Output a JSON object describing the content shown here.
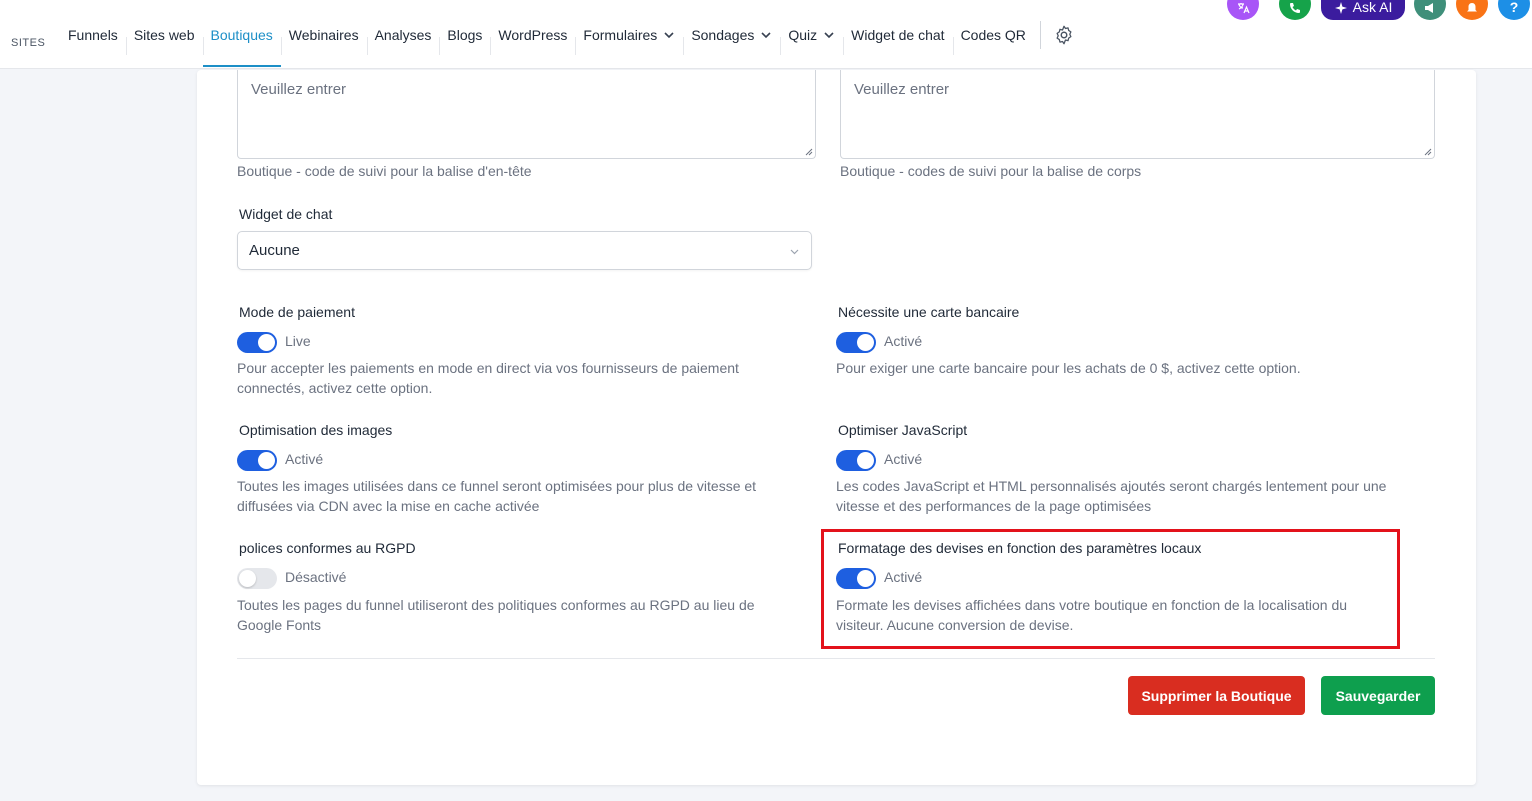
{
  "nav": {
    "sites_label": "SITES",
    "items": [
      {
        "label": "Funnels"
      },
      {
        "label": "Sites web"
      },
      {
        "label": "Boutiques",
        "active": true
      },
      {
        "label": "Webinaires"
      },
      {
        "label": "Analyses"
      },
      {
        "label": "Blogs"
      },
      {
        "label": "WordPress"
      },
      {
        "label": "Formulaires",
        "dropdown": true
      },
      {
        "label": "Sondages",
        "dropdown": true
      },
      {
        "label": "Quiz",
        "dropdown": true
      },
      {
        "label": "Widget de chat"
      },
      {
        "label": "Codes QR"
      }
    ],
    "settings_icon": "gear-icon"
  },
  "topbar": {
    "ask_ai_label": "Ask AI",
    "colors": {
      "translate": "#a855f7",
      "phone": "#16a34a",
      "ask_ai": "#3b1c9e",
      "megaphone": "#3f8f7a",
      "bell": "#f97316",
      "help": "#1d8fe6"
    }
  },
  "tracking": {
    "head_placeholder": "Veuillez entrer",
    "head_hint": "Boutique - code de suivi pour la balise d'en-tête",
    "body_placeholder": "Veuillez entrer",
    "body_hint": "Boutique - codes de suivi pour la balise de corps"
  },
  "chat_widget": {
    "label": "Widget de chat",
    "value": "Aucune"
  },
  "settings": {
    "payment_mode": {
      "label": "Mode de paiement",
      "state": "Live",
      "on": true,
      "hint_line1": "Pour accepter les paiements en mode en direct via vos fournisseurs de paiement",
      "hint_line2": "connectés, activez cette option."
    },
    "card_required": {
      "label": "Nécessite une carte bancaire",
      "state": "Activé",
      "on": true,
      "hint_line1": "Pour exiger une carte bancaire pour les achats de 0 $, activez cette option."
    },
    "image_opt": {
      "label": "Optimisation des images",
      "state": "Activé",
      "on": true,
      "hint_line1": "Toutes les images utilisées dans ce funnel seront optimisées pour plus de vitesse et",
      "hint_line2": "diffusées via CDN avec la mise en cache activée"
    },
    "js_opt": {
      "label": "Optimiser JavaScript",
      "state": "Activé",
      "on": true,
      "hint_line1": "Les codes JavaScript et HTML personnalisés ajoutés seront chargés lentement pour une",
      "hint_line2": "vitesse et des performances de la page optimisées"
    },
    "gdpr_fonts": {
      "label": "polices conformes au RGPD",
      "state": "Désactivé",
      "on": false,
      "hint_line1": "Toutes les pages du funnel utiliseront des politiques conformes au RGPD au lieu de",
      "hint_line2": "Google Fonts"
    },
    "currency_format": {
      "label": "Formatage des devises en fonction des paramètres locaux",
      "state": "Activé",
      "on": true,
      "hint_line1": "Formate les devises affichées dans votre boutique en fonction de la localisation du",
      "hint_line2": "visiteur. Aucune conversion de devise."
    }
  },
  "actions": {
    "delete_label": "Supprimer la Boutique",
    "save_label": "Sauvegarder",
    "colors": {
      "delete": "#d92d20",
      "save": "#0e9f4e"
    }
  },
  "highlight_color": "#e3121b"
}
